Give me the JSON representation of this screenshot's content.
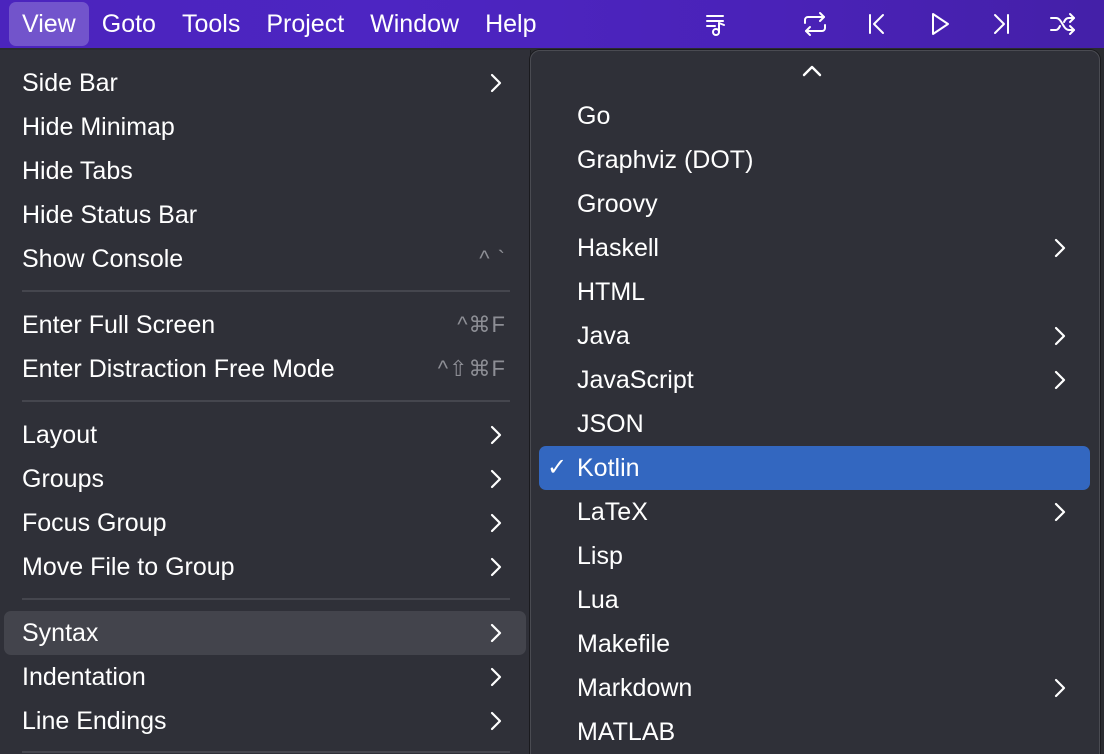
{
  "menubar": {
    "items": [
      "View",
      "Goto",
      "Tools",
      "Project",
      "Window",
      "Help"
    ],
    "active": "View",
    "icons": [
      "music-queue-icon",
      "repeat-icon",
      "skip-back-icon",
      "play-icon",
      "skip-forward-icon",
      "shuffle-icon"
    ]
  },
  "view_menu": {
    "items": [
      {
        "label": "Side Bar",
        "submenu": true
      },
      {
        "label": "Hide Minimap"
      },
      {
        "label": "Hide Tabs"
      },
      {
        "label": "Hide Status Bar"
      },
      {
        "label": "Show Console",
        "shortcut": "^ `"
      },
      {
        "label": "Enter Full Screen",
        "shortcut": "^⌘F"
      },
      {
        "label": "Enter Distraction Free Mode",
        "shortcut": "^⇧⌘F"
      },
      {
        "label": "Layout",
        "submenu": true
      },
      {
        "label": "Groups",
        "submenu": true
      },
      {
        "label": "Focus Group",
        "submenu": true
      },
      {
        "label": "Move File to Group",
        "submenu": true
      },
      {
        "label": "Syntax",
        "submenu": true,
        "highlighted": true
      },
      {
        "label": "Indentation",
        "submenu": true
      },
      {
        "label": "Line Endings",
        "submenu": true
      }
    ]
  },
  "syntax_menu": {
    "scroll_indicator": "up-chevron-icon",
    "items": [
      {
        "label": "Go"
      },
      {
        "label": "Graphviz (DOT)"
      },
      {
        "label": "Groovy"
      },
      {
        "label": "Haskell",
        "submenu": true
      },
      {
        "label": "HTML"
      },
      {
        "label": "Java",
        "submenu": true
      },
      {
        "label": "JavaScript",
        "submenu": true
      },
      {
        "label": "JSON"
      },
      {
        "label": "Kotlin",
        "checked": true,
        "selected": true
      },
      {
        "label": "LaTeX",
        "submenu": true
      },
      {
        "label": "Lisp"
      },
      {
        "label": "Lua"
      },
      {
        "label": "Makefile"
      },
      {
        "label": "Markdown",
        "submenu": true
      },
      {
        "label": "MATLAB"
      }
    ],
    "check_mark": "✓"
  },
  "colors": {
    "menubar": "#4b24bd",
    "menu_bg": "#2f3038",
    "selection": "#3367c0",
    "hover": "#43444c"
  }
}
